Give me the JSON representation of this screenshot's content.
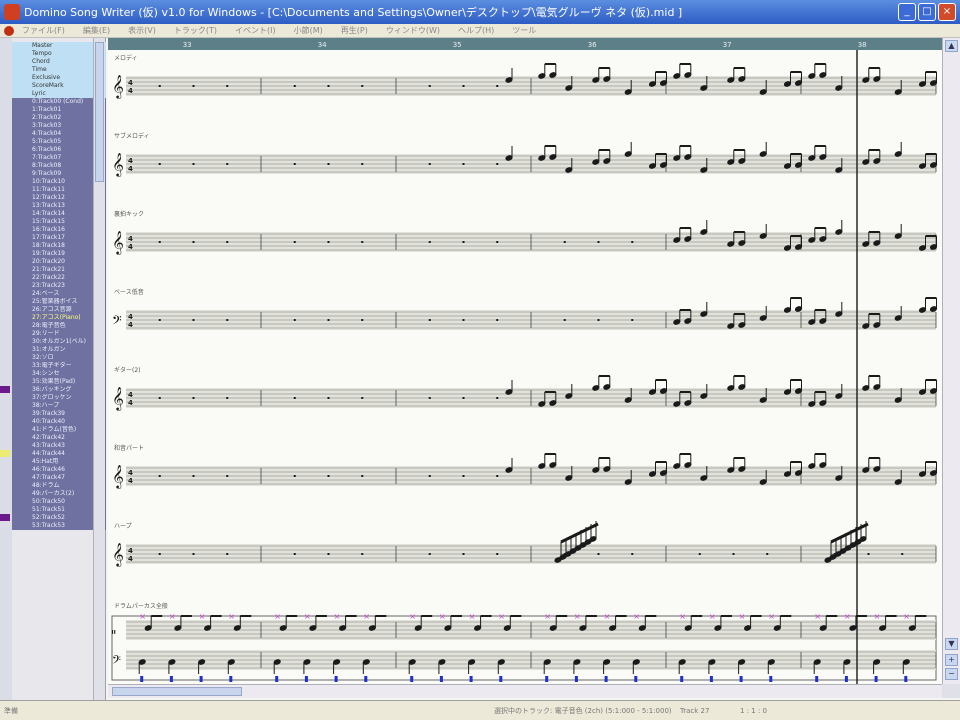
{
  "window": {
    "title": "Domino Song Writer (仮) v1.0 for Windows - [C:\\Documents and Settings\\Owner\\デスクトップ\\電気グルーヴ ネタ (仮).mid ]",
    "minimize_label": "_",
    "maximize_label": "□",
    "close_label": "×"
  },
  "menu": {
    "items": [
      "ファイル(F)",
      "編集(E)",
      "表示(V)",
      "トラック(T)",
      "イベント(I)",
      "小節(M)",
      "再生(P)",
      "ウィンドウ(W)",
      "ヘルプ(H)",
      "ツール"
    ]
  },
  "sidebar": {
    "header_items": [
      "Master",
      "Tempo",
      "Chord",
      "Time",
      "Exclusive",
      "ScoreMark",
      "Lyric"
    ],
    "tracks": [
      "0:Track00 (Cond)",
      "1:Track01",
      "2:Track02",
      "3:Track03",
      "4:Track04",
      "5:Track05",
      "6:Track06",
      "7:Track07",
      "8:Track08",
      "9:Track09",
      "10:Track10",
      "11:Track11",
      "12:Track12",
      "13:Track13",
      "14:Track14",
      "15:Track15",
      "16:Track16",
      "17:Track17",
      "18:Track18",
      "19:Track19",
      "20:Track20",
      "21:Track21",
      "22:Track22",
      "23:Track23",
      "24:ベース",
      "25:管楽器ボイス",
      "26:アコス音源",
      "27:アコス(Piano)",
      "28:電子音色",
      "29:リード",
      "30:オルガン1(ベル)",
      "31:オルガン",
      "32:ソロ",
      "33:電子ギター",
      "34:シンセ",
      "35:効果音(Pad)",
      "36:バッキング",
      "37:グロッケン",
      "38:ハープ",
      "39:Track39",
      "40:Track40",
      "41:ドラム(音色)",
      "42:Track42",
      "43:Track43",
      "44:Track44",
      "45:Hat用",
      "46:Track46",
      "47:Track47",
      "48:ドラム",
      "49:パーカス(2)",
      "50:Track50",
      "51:Track51",
      "52:Track52",
      "53:Track53"
    ],
    "selected_track_index": 27,
    "mark_colors": [
      "#6a1a8a",
      "#ecec70",
      "#6a1a8a",
      "#ecec70",
      "#6a1a8a",
      "#ecec70",
      "#ecec70"
    ]
  },
  "score": {
    "measure_numbers": [
      "33",
      "34",
      "35",
      "36",
      "37",
      "38"
    ],
    "staves": [
      {
        "label": "メロディ",
        "clef": "treble",
        "notes_start_measure": 3
      },
      {
        "label": "サブメロディ",
        "clef": "treble",
        "notes_start_measure": 3
      },
      {
        "label": "裏拍キック",
        "clef": "treble",
        "notes_start_measure": 4
      },
      {
        "label": "ベース低音",
        "clef": "bass",
        "notes_start_measure": 4
      },
      {
        "label": "ギター(2)",
        "clef": "treble",
        "notes_start_measure": 3
      },
      {
        "label": "和音パート",
        "clef": "treble",
        "notes_start_measure": 3
      },
      {
        "label": "ハープ",
        "clef": "treble",
        "notes_start_measure": 99
      }
    ],
    "drum_label": "ドラムパーカス全般",
    "time_signature": "4/4",
    "accent_color": "#1a1a1a",
    "pitch_mark_color": "#d040d0",
    "kick_mark_color": "#2030d0",
    "playhead_color": "#1a1a1a"
  },
  "status": {
    "left": "準備",
    "mid": "選択中のトラック: 電子音色 (2ch) (5:1:000 - 5:1:000)",
    "pos": "Track 27",
    "tail": "1 : 1 : 0"
  }
}
